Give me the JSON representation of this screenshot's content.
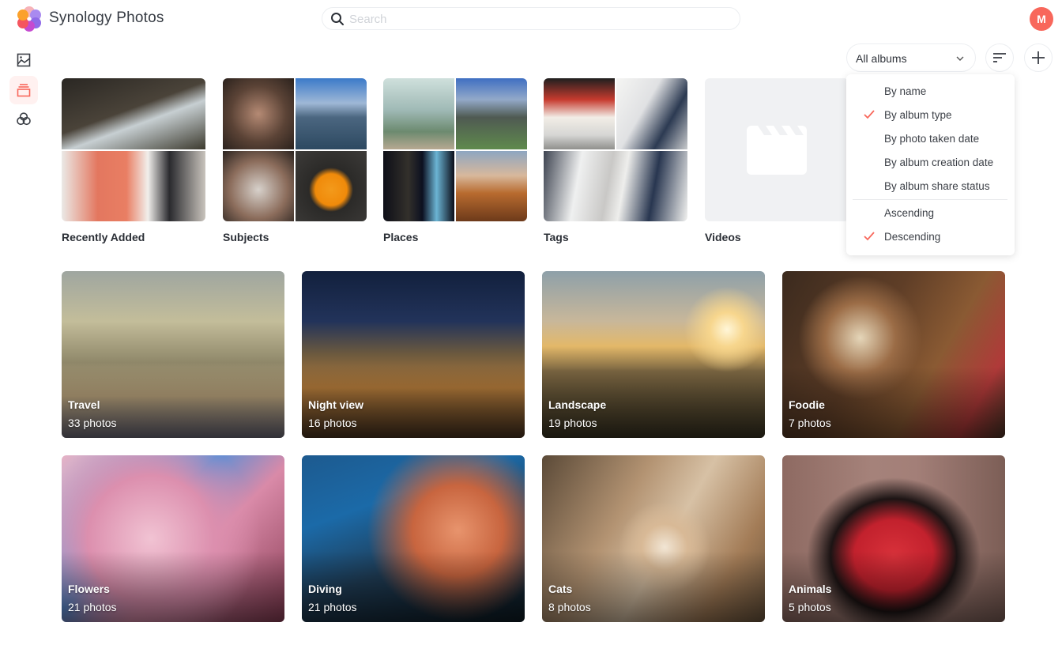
{
  "app": {
    "title": "Synology Photos",
    "avatar_initial": "M",
    "accent_color": "#f8675b"
  },
  "search": {
    "placeholder": "Search",
    "value": ""
  },
  "sidebar": {
    "items": [
      {
        "name": "photos",
        "icon": "image-icon",
        "active": false
      },
      {
        "name": "albums",
        "icon": "albums-icon",
        "active": true
      },
      {
        "name": "shared",
        "icon": "shared-icon",
        "active": false
      }
    ]
  },
  "toolbar": {
    "filter_selected": "All albums",
    "sort_icon": "sort-icon",
    "add_icon": "plus-icon"
  },
  "sort_menu": {
    "sort_by": [
      {
        "label": "By name",
        "checked": false
      },
      {
        "label": "By album type",
        "checked": true
      },
      {
        "label": "By photo taken date",
        "checked": false
      },
      {
        "label": "By album creation date",
        "checked": false
      },
      {
        "label": "By album share status",
        "checked": false
      }
    ],
    "order": [
      {
        "label": "Ascending",
        "checked": false
      },
      {
        "label": "Descending",
        "checked": true
      }
    ]
  },
  "categories": [
    {
      "label": "Recently Added"
    },
    {
      "label": "Subjects"
    },
    {
      "label": "Places"
    },
    {
      "label": "Tags"
    },
    {
      "label": "Videos"
    }
  ],
  "albums": [
    {
      "name": "Travel",
      "count": "33 photos"
    },
    {
      "name": "Night view",
      "count": "16 photos"
    },
    {
      "name": "Landscape",
      "count": "19 photos"
    },
    {
      "name": "Foodie",
      "count": "7 photos"
    },
    {
      "name": "Flowers",
      "count": "21 photos"
    },
    {
      "name": "Diving",
      "count": "21 photos"
    },
    {
      "name": "Cats",
      "count": "8 photos"
    },
    {
      "name": "Animals",
      "count": "5 photos"
    }
  ]
}
